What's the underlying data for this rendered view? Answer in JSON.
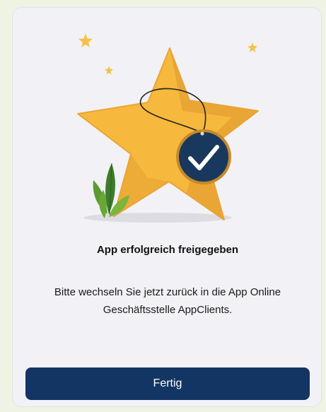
{
  "dialog": {
    "title": "App erfolgreich freigegeben",
    "message": "Bitte wechseln Sie jetzt zurück in die App Online Geschäftsstelle AppClients.",
    "done_label": "Fertig"
  },
  "illustration": {
    "subject": "star-with-checkmark-medal",
    "icons": [
      "sparkle-star-icon",
      "checkmark-icon",
      "leaf-plant-icon"
    ]
  },
  "colors": {
    "page_background": "#eef3e4",
    "card_background": "#f2f2f6",
    "button_background": "#133563",
    "button_text": "#ffffff",
    "star_fill": "#f6b93d",
    "star_shade": "#e09c2a",
    "medal_fill": "#18385e",
    "leaf_green": "#5e9a32"
  }
}
